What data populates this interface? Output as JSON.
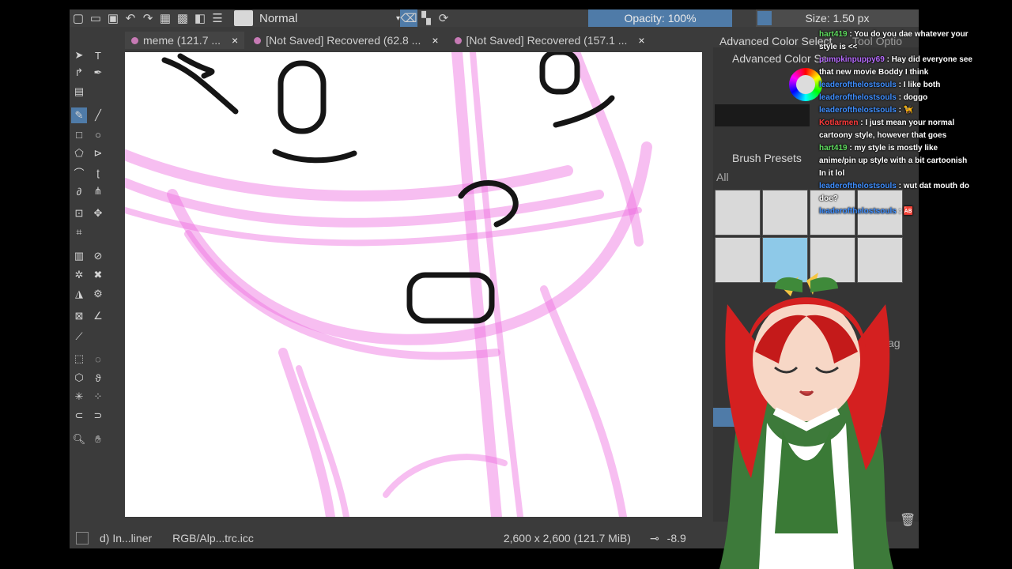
{
  "toolbar": {
    "blend_mode": "Normal",
    "opacity": "Opacity: 100%",
    "size": "Size: 1.50 px"
  },
  "tabs": [
    {
      "label": "meme (121.7 ...",
      "close": "×"
    },
    {
      "label": "[Not Saved]  Recovered (62.8 ...",
      "close": "×"
    },
    {
      "label": "[Not Saved]  Recovered (157.1 ...",
      "close": "×"
    }
  ],
  "docker": {
    "color_tab": "Advanced Color Select",
    "tool_options_tab": "Tool Optio",
    "color_title": "Advanced Color Se",
    "brush_presets_title": "Brush Presets",
    "brush_filter": "All",
    "tag_label": "Tag"
  },
  "status": {
    "brush_name": "d) In...liner",
    "color_profile": "RGB/Alp...trc.icc",
    "dimensions": "2,600 x 2,600 (121.7 MiB)",
    "rotation": "-8.9"
  },
  "chat": [
    {
      "user": "hart419",
      "text": " : You do you dae whatever your style is <<",
      "color": "#5fdc5f"
    },
    {
      "user": "pumpkinpuppy69",
      "text": " : Hay did everyone see that new movie Boddy I think",
      "color": "#b76bff"
    },
    {
      "user": "leaderofthelostsouls",
      "text": " : I like both",
      "color": "#3f8fff"
    },
    {
      "user": "leaderofthelostsouls",
      "text": " : doggo",
      "color": "#3f8fff"
    },
    {
      "user": "leaderofthelostsouls",
      "text": " : 🦮",
      "color": "#3f8fff"
    },
    {
      "user": "Kotlarmen",
      "text": " : I just mean your normal cartoony style, however that goes",
      "color": "#ff3b3b"
    },
    {
      "user": "hart419",
      "text": " : my style is mostly like anime/pin up style with a bit cartoonish In it lol",
      "color": "#5fdc5f"
    },
    {
      "user": "leaderofthelostsouls",
      "text": " : wut dat mouth do doe?",
      "color": "#3f8fff"
    },
    {
      "user": "leaderofthelostsouls",
      "text": " : 🆎",
      "color": "#3f8fff"
    }
  ],
  "colors": {
    "accent": "#4f7ba8",
    "sketch": "#ee6ee0"
  }
}
